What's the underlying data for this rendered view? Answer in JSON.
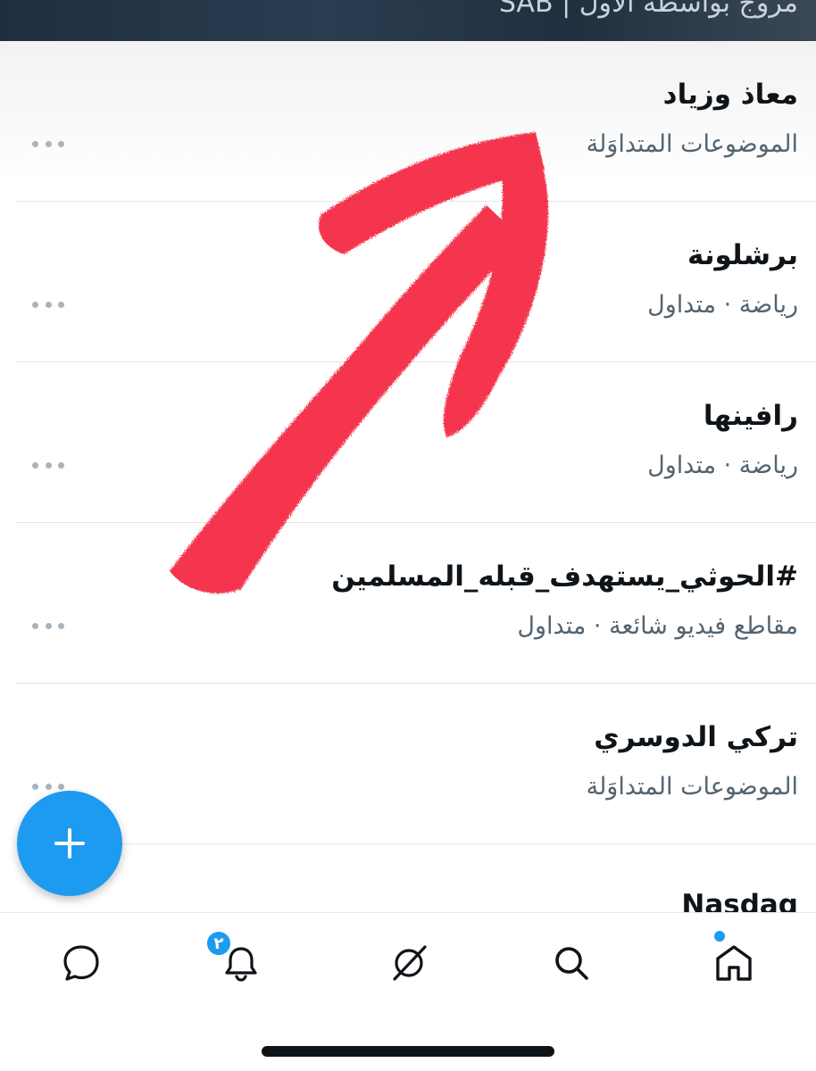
{
  "header": {
    "promoted_text": "مروج بواسطة الأول | SAB"
  },
  "trends": [
    {
      "title": "معاذ وزياد",
      "meta": "الموضوعات المتداوَلة"
    },
    {
      "title": "برشلونة",
      "meta": "رياضة · متداول"
    },
    {
      "title": "رافينها",
      "meta": "رياضة · متداول"
    },
    {
      "title": "#الحوثي_يستهدف_قبله_المسلمين",
      "meta": "مقاطع فيديو شائعة · متداول"
    },
    {
      "title": "تركي الدوسري",
      "meta": "الموضوعات المتداوَلة"
    },
    {
      "title": "Nasdaq"
    }
  ],
  "bottom_nav": {
    "items": [
      {
        "icon": "messages-icon"
      },
      {
        "icon": "notifications-icon",
        "badge": "٢"
      },
      {
        "icon": "grok-icon"
      },
      {
        "icon": "search-icon"
      },
      {
        "icon": "home-icon",
        "has_dot": true
      }
    ]
  },
  "colors": {
    "accent": "#1d9bf0",
    "annotation_arrow": "#f4283f",
    "primary_text": "#0f1419",
    "secondary_text": "#536471"
  }
}
